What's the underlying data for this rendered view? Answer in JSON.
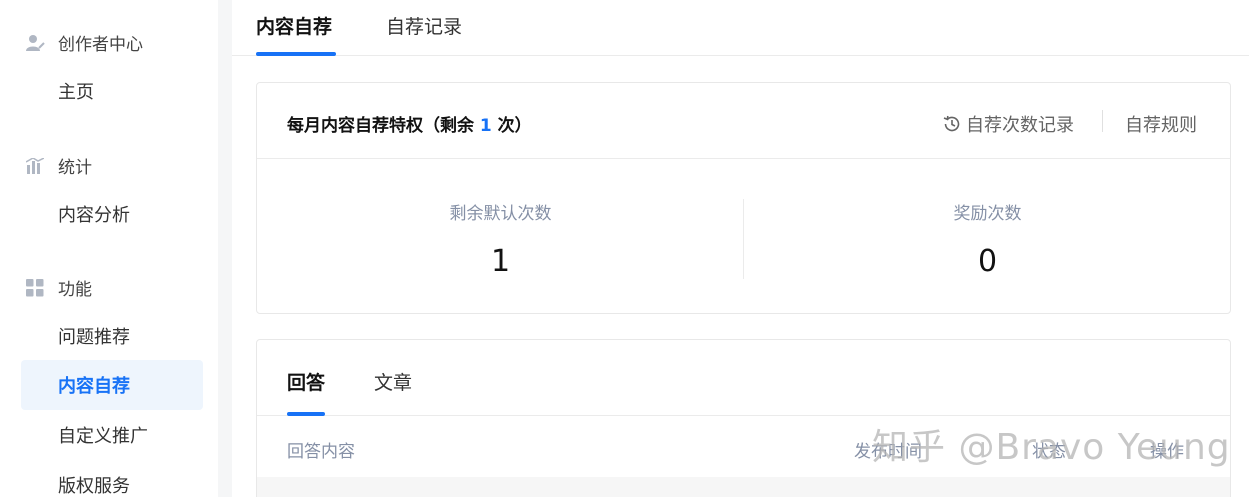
{
  "sidebar": {
    "groups": [
      {
        "label": "创作者中心",
        "icon": "creator-icon",
        "items": [
          {
            "label": "主页"
          }
        ]
      },
      {
        "label": "统计",
        "icon": "chart-icon",
        "items": [
          {
            "label": "内容分析"
          }
        ]
      },
      {
        "label": "功能",
        "icon": "grid-icon",
        "items": [
          {
            "label": "问题推荐"
          },
          {
            "label": "内容自荐",
            "active": true
          },
          {
            "label": "自定义推广"
          },
          {
            "label": "版权服务"
          }
        ]
      }
    ]
  },
  "tabs": [
    {
      "label": "内容自荐",
      "active": true
    },
    {
      "label": "自荐记录"
    }
  ],
  "privilege_card": {
    "title_prefix": "每月内容自荐特权（剩余 ",
    "remaining": "1",
    "title_suffix": " 次）",
    "history_link": "自荐次数记录",
    "history_icon": "history-clock-icon",
    "rules_link": "自荐规则",
    "stats": [
      {
        "label": "剩余默认次数",
        "value": "1"
      },
      {
        "label": "奖励次数",
        "value": "0"
      }
    ]
  },
  "content_card": {
    "tabs": [
      {
        "label": "回答",
        "active": true
      },
      {
        "label": "文章"
      }
    ],
    "columns": [
      "回答内容",
      "发布时间",
      "状态",
      "操作"
    ]
  },
  "watermark": "知乎 @Bravo Yeung",
  "colors": {
    "accent": "#1772f6",
    "active_bg": "#eef5fd",
    "muted": "#8590a6"
  }
}
